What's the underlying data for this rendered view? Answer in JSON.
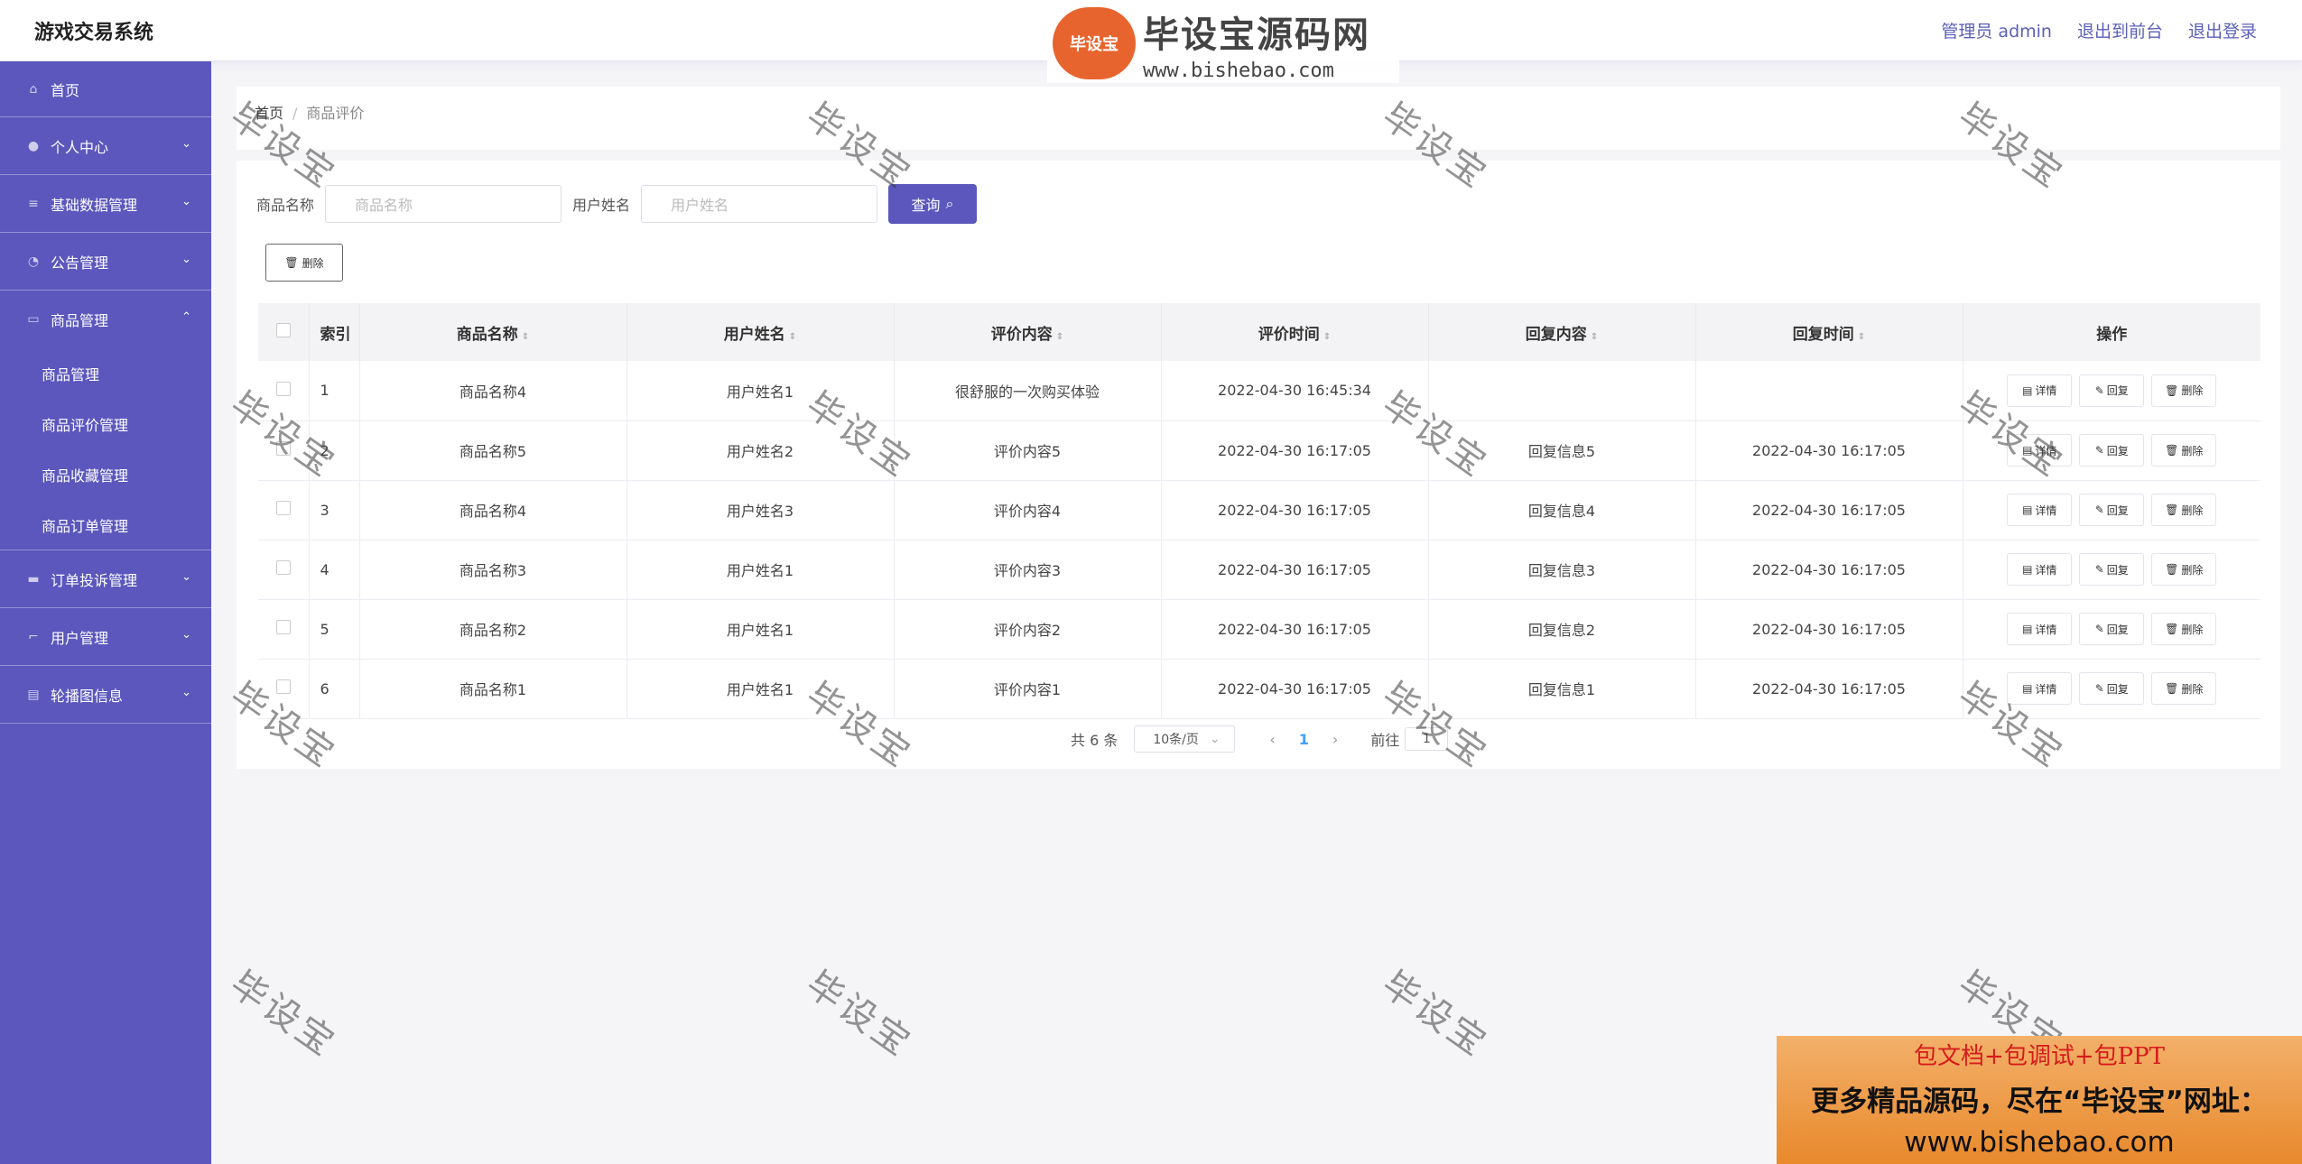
{
  "header": {
    "app_title": "游戏交易系统",
    "admin_label": "管理员 admin",
    "to_front": "退出到前台",
    "logout": "退出登录"
  },
  "sidebar": {
    "items": [
      {
        "label": "首页",
        "icon": "home-icon"
      },
      {
        "label": "个人中心",
        "icon": "user-icon"
      },
      {
        "label": "基础数据管理",
        "icon": "list-icon"
      },
      {
        "label": "公告管理",
        "icon": "gauge-icon"
      },
      {
        "label": "商品管理",
        "icon": "message-icon"
      },
      {
        "label": "订单投诉管理",
        "icon": "monitor-icon"
      },
      {
        "label": "用户管理",
        "icon": "crop-icon"
      },
      {
        "label": "轮播图信息",
        "icon": "stack-icon"
      }
    ],
    "sub_items": [
      "商品管理",
      "商品评价管理",
      "商品收藏管理",
      "商品订单管理"
    ]
  },
  "breadcrumb": {
    "home": "首页",
    "current": "商品评价"
  },
  "search": {
    "product_label": "商品名称",
    "product_placeholder": "商品名称",
    "user_label": "用户姓名",
    "user_placeholder": "用户姓名",
    "query_button": "查询"
  },
  "toolbar": {
    "delete_button": "删除"
  },
  "table": {
    "headers": [
      "索引",
      "商品名称",
      "用户姓名",
      "评价内容",
      "评价时间",
      "回复内容",
      "回复时间",
      "操作"
    ],
    "actions": {
      "detail": "详情",
      "reply": "回复",
      "delete": "删除"
    },
    "rows": [
      {
        "idx": "1",
        "product": "商品名称4",
        "user": "用户姓名1",
        "content": "很舒服的一次购买体验",
        "time": "2022-04-30 16:45:34",
        "reply": "",
        "reply_time": ""
      },
      {
        "idx": "2",
        "product": "商品名称5",
        "user": "用户姓名2",
        "content": "评价内容5",
        "time": "2022-04-30 16:17:05",
        "reply": "回复信息5",
        "reply_time": "2022-04-30 16:17:05"
      },
      {
        "idx": "3",
        "product": "商品名称4",
        "user": "用户姓名3",
        "content": "评价内容4",
        "time": "2022-04-30 16:17:05",
        "reply": "回复信息4",
        "reply_time": "2022-04-30 16:17:05"
      },
      {
        "idx": "4",
        "product": "商品名称3",
        "user": "用户姓名1",
        "content": "评价内容3",
        "time": "2022-04-30 16:17:05",
        "reply": "回复信息3",
        "reply_time": "2022-04-30 16:17:05"
      },
      {
        "idx": "5",
        "product": "商品名称2",
        "user": "用户姓名1",
        "content": "评价内容2",
        "time": "2022-04-30 16:17:05",
        "reply": "回复信息2",
        "reply_time": "2022-04-30 16:17:05"
      },
      {
        "idx": "6",
        "product": "商品名称1",
        "user": "用户姓名1",
        "content": "评价内容1",
        "time": "2022-04-30 16:17:05",
        "reply": "回复信息1",
        "reply_time": "2022-04-30 16:17:05"
      }
    ]
  },
  "pagination": {
    "total": "共 6 条",
    "page_size": "10条/页",
    "current": "1",
    "goto_label": "前往",
    "goto_value": "1"
  },
  "watermark": {
    "text": "毕设宝"
  },
  "logo": {
    "badge": "毕设宝",
    "name": "毕设宝源码网",
    "url": "www.bishebao.com"
  },
  "ad": {
    "line1": "包文档+包调试+包PPT",
    "line2": "更多精品源码，尽在“毕设宝”网址：",
    "line3": "www.bishebao.com"
  },
  "colors": {
    "primary": "#5b57bd",
    "link": "#409eff",
    "ad_red": "#d61b1b"
  }
}
